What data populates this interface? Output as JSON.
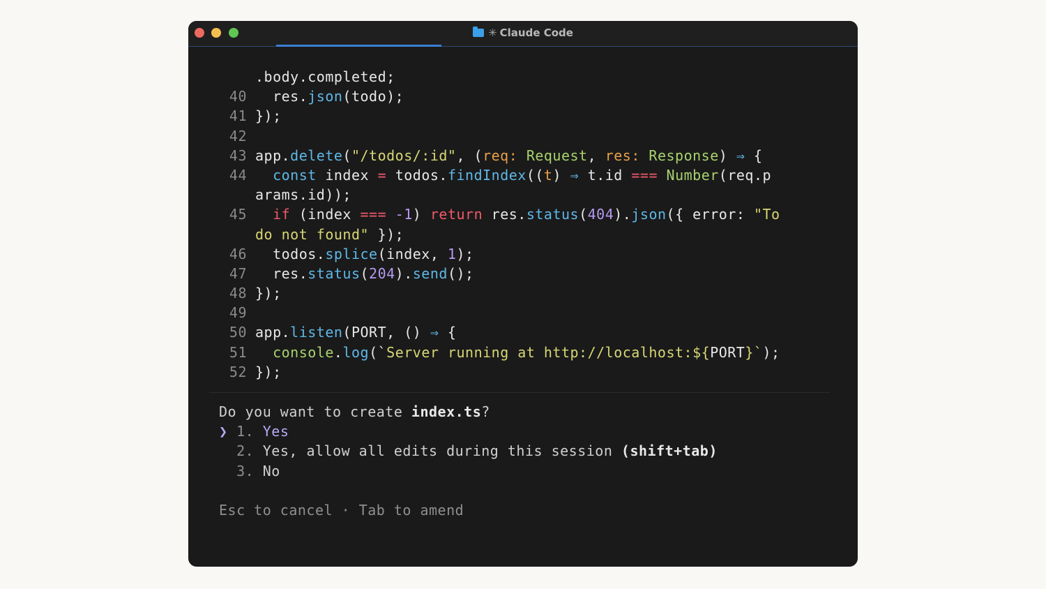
{
  "window": {
    "title": "Claude Code",
    "title_icon": "folder-icon"
  },
  "code": {
    "lines": [
      {
        "n": "",
        "parts": [
          {
            "t": ".body.completed;",
            "c": ""
          }
        ]
      },
      {
        "n": "40",
        "parts": [
          {
            "t": "  res.",
            "c": ""
          },
          {
            "t": "json",
            "c": "fn"
          },
          {
            "t": "(todo);",
            "c": ""
          }
        ]
      },
      {
        "n": "41",
        "parts": [
          {
            "t": "});",
            "c": ""
          }
        ]
      },
      {
        "n": "42",
        "parts": []
      },
      {
        "n": "43",
        "parts": [
          {
            "t": "app.",
            "c": ""
          },
          {
            "t": "delete",
            "c": "fn"
          },
          {
            "t": "(",
            "c": ""
          },
          {
            "t": "\"/todos/:id\"",
            "c": "str"
          },
          {
            "t": ", (",
            "c": ""
          },
          {
            "t": "req:",
            "c": "param"
          },
          {
            "t": " ",
            "c": ""
          },
          {
            "t": "Request",
            "c": "ty"
          },
          {
            "t": ", ",
            "c": ""
          },
          {
            "t": "res:",
            "c": "param"
          },
          {
            "t": " ",
            "c": ""
          },
          {
            "t": "Response",
            "c": "ty"
          },
          {
            "t": ") ",
            "c": ""
          },
          {
            "t": "⇒",
            "c": "kw"
          },
          {
            "t": " {",
            "c": ""
          }
        ]
      },
      {
        "n": "44",
        "parts": [
          {
            "t": "  ",
            "c": ""
          },
          {
            "t": "const",
            "c": "kw"
          },
          {
            "t": " index ",
            "c": ""
          },
          {
            "t": "=",
            "c": "red"
          },
          {
            "t": " todos.",
            "c": ""
          },
          {
            "t": "findIndex",
            "c": "fn"
          },
          {
            "t": "((",
            "c": ""
          },
          {
            "t": "t",
            "c": "param"
          },
          {
            "t": ") ",
            "c": ""
          },
          {
            "t": "⇒",
            "c": "kw"
          },
          {
            "t": " t.id ",
            "c": ""
          },
          {
            "t": "===",
            "c": "red"
          },
          {
            "t": " ",
            "c": ""
          },
          {
            "t": "Number",
            "c": "ty"
          },
          {
            "t": "(req.p",
            "c": ""
          }
        ]
      },
      {
        "n": "",
        "parts": [
          {
            "t": "arams.id));",
            "c": ""
          }
        ]
      },
      {
        "n": "45",
        "parts": [
          {
            "t": "  ",
            "c": ""
          },
          {
            "t": "if",
            "c": "red"
          },
          {
            "t": " (index ",
            "c": ""
          },
          {
            "t": "===",
            "c": "red"
          },
          {
            "t": " ",
            "c": ""
          },
          {
            "t": "-1",
            "c": "num"
          },
          {
            "t": ") ",
            "c": ""
          },
          {
            "t": "return",
            "c": "red"
          },
          {
            "t": " res.",
            "c": ""
          },
          {
            "t": "status",
            "c": "fn"
          },
          {
            "t": "(",
            "c": ""
          },
          {
            "t": "404",
            "c": "num"
          },
          {
            "t": ").",
            "c": ""
          },
          {
            "t": "json",
            "c": "fn"
          },
          {
            "t": "({ error: ",
            "c": ""
          },
          {
            "t": "\"To",
            "c": "str"
          }
        ]
      },
      {
        "n": "",
        "parts": [
          {
            "t": "do not found\"",
            "c": "str"
          },
          {
            "t": " });",
            "c": ""
          }
        ]
      },
      {
        "n": "46",
        "parts": [
          {
            "t": "  todos.",
            "c": ""
          },
          {
            "t": "splice",
            "c": "fn"
          },
          {
            "t": "(index, ",
            "c": ""
          },
          {
            "t": "1",
            "c": "num"
          },
          {
            "t": ");",
            "c": ""
          }
        ]
      },
      {
        "n": "47",
        "parts": [
          {
            "t": "  res.",
            "c": ""
          },
          {
            "t": "status",
            "c": "fn"
          },
          {
            "t": "(",
            "c": ""
          },
          {
            "t": "204",
            "c": "num"
          },
          {
            "t": ").",
            "c": ""
          },
          {
            "t": "send",
            "c": "fn"
          },
          {
            "t": "();",
            "c": ""
          }
        ]
      },
      {
        "n": "48",
        "parts": [
          {
            "t": "});",
            "c": ""
          }
        ]
      },
      {
        "n": "49",
        "parts": []
      },
      {
        "n": "50",
        "parts": [
          {
            "t": "app.",
            "c": ""
          },
          {
            "t": "listen",
            "c": "fn"
          },
          {
            "t": "(PORT, () ",
            "c": ""
          },
          {
            "t": "⇒",
            "c": "kw"
          },
          {
            "t": " {",
            "c": ""
          }
        ]
      },
      {
        "n": "51",
        "parts": [
          {
            "t": "  ",
            "c": ""
          },
          {
            "t": "console",
            "c": "ty"
          },
          {
            "t": ".",
            "c": ""
          },
          {
            "t": "log",
            "c": "fn"
          },
          {
            "t": "(`",
            "c": ""
          },
          {
            "t": "Server running at http://localhost:${",
            "c": "str"
          },
          {
            "t": "PORT",
            "c": ""
          },
          {
            "t": "}`",
            "c": "str"
          },
          {
            "t": ");",
            "c": ""
          }
        ]
      },
      {
        "n": "52",
        "parts": [
          {
            "t": "});",
            "c": ""
          }
        ]
      }
    ]
  },
  "prompt": {
    "question_prefix": "Do you want to create ",
    "filename": "index.ts",
    "question_suffix": "?",
    "cursor": "❯",
    "options": [
      {
        "num": "1.",
        "label": "Yes",
        "hint": ""
      },
      {
        "num": "2.",
        "label": "Yes, allow all edits during this session ",
        "hint": "(shift+tab)"
      },
      {
        "num": "3.",
        "label": "No",
        "hint": ""
      }
    ],
    "footer": "Esc to cancel · Tab to amend"
  },
  "colors": {
    "background": "#f9f8f4",
    "terminal": "#1a1a1a",
    "function": "#5fb8e8",
    "string": "#d7d775",
    "type": "#a8d36e",
    "param": "#e8a04a",
    "number": "#b59bf0",
    "keyword_red": "#f05a6b",
    "selected": "#b7a9f5"
  }
}
